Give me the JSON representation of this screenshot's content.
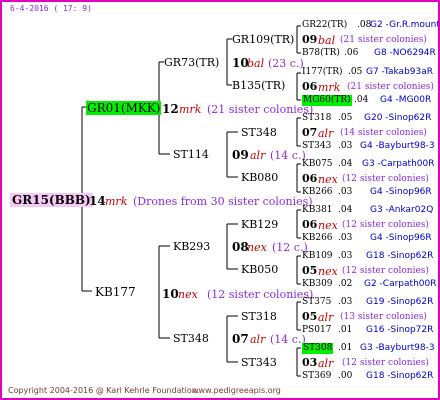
{
  "header": {
    "date": "6-4-2016 ( 17: 9)"
  },
  "footer": {
    "copyright": "Copyright 2004-2016 @ Karl Kehrle Foundation.",
    "url": "www.pedigreeapis.org"
  },
  "root": {
    "name": "GR15(BBB)"
  },
  "gen1": {
    "text_num": "14",
    "text_type": "mrk",
    "text_note": "(Drones from 30 sister colonies)",
    "mother": "GR01(MKK)",
    "father": "KB177"
  },
  "upper": {
    "text_num": "12",
    "text_type": "mrk",
    "text_note": "(21 sister colonies)",
    "mother": "GR73(TR)",
    "father": "ST114",
    "gr73": {
      "text_num": "10",
      "text_type": "bal",
      "text_note": "(23 c.)",
      "mother": "GR109(TR)",
      "father": "B135(TR)",
      "gr109": {
        "text_num": "09",
        "text_type": "bal",
        "text_note": "(21 sister colonies)",
        "mother": "GR22(TR)",
        "mother_year": ".08",
        "mother_code": "G2 -Gr.R.mounta",
        "father": "B78(TR)",
        "father_year": ".06",
        "father_code": "G8 -NO6294R"
      },
      "b135": {
        "text_num": "06",
        "text_type": "mrk",
        "text_note": "(21 sister colonies)",
        "mother": "I177(TR)",
        "mother_year": ".05",
        "mother_code": "G7 -Takab93aR",
        "father": "MG60(TR)",
        "father_year": ".04",
        "father_code": "G4 -MG00R"
      }
    },
    "st114": {
      "text_num": "09",
      "text_type": "alr",
      "text_note": "(14 c.)",
      "mother": "ST348",
      "father": "KB080",
      "st348": {
        "text_num": "07",
        "text_type": "alr",
        "text_note": "(14 sister colonies)",
        "mother": "ST318",
        "mother_year": ".05",
        "mother_code": "G20 -Sinop62R",
        "father": "ST343",
        "father_year": ".03",
        "father_code": "G4 -Bayburt98-3"
      },
      "kb080": {
        "text_num": "06",
        "text_type": "nex",
        "text_note": "(12 sister colonies)",
        "mother": "KB075",
        "mother_year": ".04",
        "mother_code": "G3 -Carpath00R",
        "father": "KB266",
        "father_year": ".03",
        "father_code": "G4 -Sinop96R"
      }
    }
  },
  "lower": {
    "text_num": "10",
    "text_type": "nex",
    "text_note": "(12 sister colonies)",
    "mother": "KB293",
    "father": "ST348",
    "kb293": {
      "text_num": "08",
      "text_type": "nex",
      "text_note": "(12 c.)",
      "mother": "KB129",
      "father": "KB050",
      "kb129": {
        "text_num": "06",
        "text_type": "nex",
        "text_note": "(12 sister colonies)",
        "mother": "KB381",
        "mother_year": ".04",
        "mother_code": "G3 -Ankar02Q",
        "father": "KB266",
        "father_year": ".03",
        "father_code": "G4 -Sinop96R"
      },
      "kb050": {
        "text_num": "05",
        "text_type": "nex",
        "text_note": "(12 sister colonies)",
        "mother": "KB109",
        "mother_year": ".03",
        "mother_code": "G18 -Sinop62R",
        "father": "KB309",
        "father_year": ".02",
        "father_code": "G2 -Carpath00R"
      }
    },
    "st348": {
      "text_num": "07",
      "text_type": "alr",
      "text_note": "(14 c.)",
      "mother": "ST318",
      "father": "ST343",
      "st318": {
        "text_num": "05",
        "text_type": "alr",
        "text_note": "(13 sister colonies)",
        "mother": "ST375",
        "mother_year": ".03",
        "mother_code": "G19 -Sinop62R",
        "father": "PS017",
        "father_year": ".01",
        "father_code": "G16 -Sinop72R"
      },
      "st343": {
        "text_num": "03",
        "text_type": "alr",
        "text_note": "(12 sister colonies)",
        "mother": "ST308",
        "mother_year": ".01",
        "mother_code": "G3 -Bayburt98-3",
        "father": "ST369",
        "father_year": ".00",
        "father_code": "G18 -Sinop62R"
      }
    }
  }
}
